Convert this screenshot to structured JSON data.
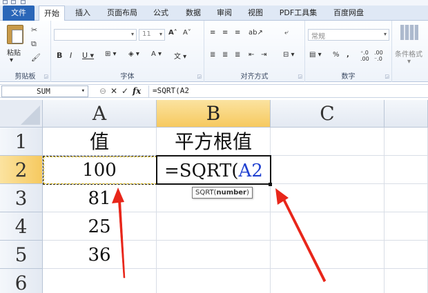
{
  "tabs": [
    {
      "label": "文件"
    },
    {
      "label": "开始"
    },
    {
      "label": "插入"
    },
    {
      "label": "页面布局"
    },
    {
      "label": "公式"
    },
    {
      "label": "数据"
    },
    {
      "label": "审阅"
    },
    {
      "label": "视图"
    },
    {
      "label": "PDF工具集"
    },
    {
      "label": "百度网盘"
    }
  ],
  "ribbon": {
    "clipboard": {
      "paste": "粘贴",
      "label": "剪贴板"
    },
    "font": {
      "size": "11",
      "label": "字体"
    },
    "alignment": {
      "label": "对齐方式"
    },
    "number": {
      "format": "常规",
      "label": "数字",
      "percent": "%",
      "comma": ","
    },
    "styles": {
      "conditional": "条件格式"
    }
  },
  "formula_bar": {
    "name_box": "SUM",
    "fx": "fx",
    "formula": "=SQRT(A2"
  },
  "grid": {
    "columns": [
      "A",
      "B",
      "C"
    ],
    "rows": [
      "1",
      "2",
      "3",
      "4",
      "5",
      "6"
    ],
    "cells": {
      "A1": "值",
      "B1": "平方根值",
      "A2": "100",
      "A3": "81",
      "A4": "25",
      "A5": "36"
    },
    "editing": {
      "prefix": "=SQRT(",
      "ref": "A2"
    },
    "tooltip": {
      "func": "SQRT(",
      "arg": "number",
      "close": ")"
    }
  },
  "colors": {
    "file_tab": "#2a66b8",
    "selected_header": "#f6c95f",
    "reference_text": "#1e3fd0",
    "annotation_arrow": "#e8261a"
  }
}
